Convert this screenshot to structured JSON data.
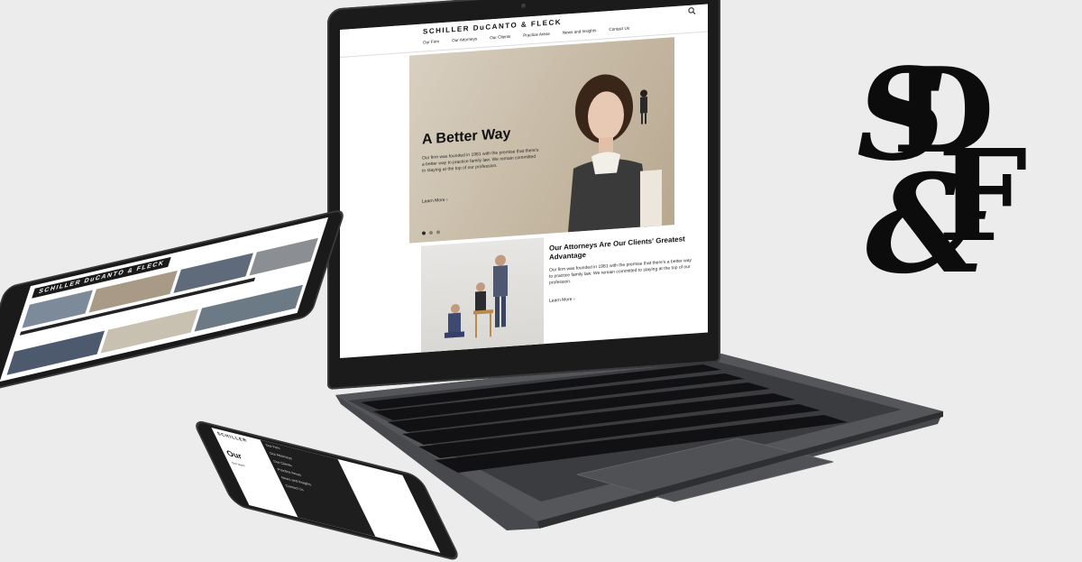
{
  "site": {
    "logo": "SCHILLER DuCANTO & FLECK",
    "nav": [
      "Our Firm",
      "Our Attorneys",
      "Our Clients",
      "Practice Areas",
      "News and Insights",
      "Contact Us"
    ],
    "hero": {
      "title": "A Better Way",
      "body": "Our firm was founded in 1981 with the premise that there's a better way to practice family law. We remain committed to staying at the top of our profession.",
      "link": "Learn More ›",
      "slide_count": 3,
      "active_slide": 1
    },
    "feature": {
      "title": "Our Attorneys Are Our Clients' Greatest Advantage",
      "body": "Our firm was founded in 1981 with the premise that there's a better way to practice family law. We remain committed to staying at the top of our profession.",
      "link": "Learn More ›"
    }
  },
  "tablet": {
    "logo": "SCHILLER DuCANTO & FLECK"
  },
  "phone": {
    "logo": "SCHILLER",
    "heading": "Our",
    "body": "Our team",
    "menu": [
      "Our Firm",
      "Our Attorneys",
      "Our Clients",
      "Practice Areas",
      "News and Insights",
      "Contact Us"
    ]
  },
  "monogram": {
    "letters": "SD&F"
  },
  "colors": {
    "background": "#ececec",
    "device": "#1b1b1c",
    "hero_tone": "#c9bda9"
  },
  "icons": [
    "search-icon"
  ]
}
